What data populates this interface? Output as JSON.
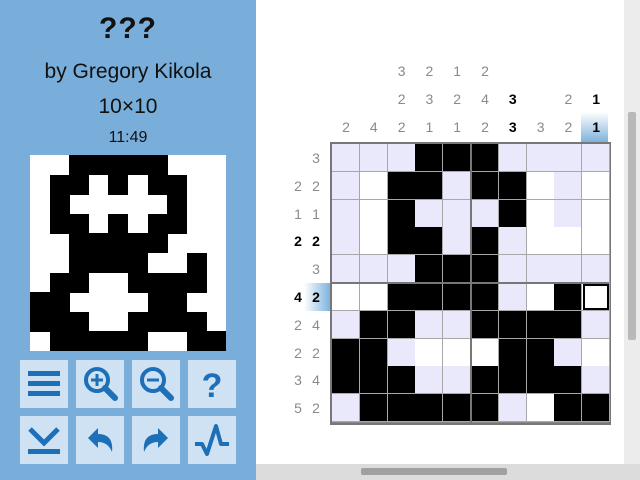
{
  "puzzle": {
    "title": "???",
    "author": "by Gregory Kikola",
    "size": "10×10",
    "timer": "11:49"
  },
  "toolbar": [
    {
      "name": "menu-button",
      "icon": "menu-icon"
    },
    {
      "name": "zoom-in-button",
      "icon": "zoom-in-icon"
    },
    {
      "name": "zoom-out-button",
      "icon": "zoom-out-icon"
    },
    {
      "name": "help-button",
      "icon": "help-icon"
    },
    {
      "name": "collapse-button",
      "icon": "collapse-down-icon"
    },
    {
      "name": "undo-button",
      "icon": "undo-icon"
    },
    {
      "name": "redo-button",
      "icon": "redo-icon"
    },
    {
      "name": "check-button",
      "icon": "check-icon"
    }
  ],
  "column_clues": [
    [
      "2"
    ],
    [
      "4"
    ],
    [
      "3",
      "2",
      "2"
    ],
    [
      "2",
      "3",
      "1"
    ],
    [
      "1",
      "2",
      "1"
    ],
    [
      "2",
      "4",
      "2"
    ],
    [
      "3",
      "3"
    ],
    [
      "3"
    ],
    [
      "2",
      "2"
    ],
    [
      "1",
      "1"
    ]
  ],
  "column_clues_complete": [
    [
      false
    ],
    [
      false
    ],
    [
      false,
      false,
      false
    ],
    [
      false,
      false,
      false
    ],
    [
      false,
      false,
      false
    ],
    [
      false,
      false,
      false
    ],
    [
      true,
      true
    ],
    [
      false
    ],
    [
      false,
      false
    ],
    [
      true,
      true
    ]
  ],
  "row_clues": [
    [
      "3"
    ],
    [
      "2",
      "2"
    ],
    [
      "1",
      "1"
    ],
    [
      "2",
      "2"
    ],
    [
      "3"
    ],
    [
      "4",
      "2"
    ],
    [
      "2",
      "4"
    ],
    [
      "2",
      "2"
    ],
    [
      "3",
      "4"
    ],
    [
      "5",
      "2"
    ]
  ],
  "row_clues_complete": [
    [
      false
    ],
    [
      false,
      false
    ],
    [
      false,
      false
    ],
    [
      true,
      true
    ],
    [
      false
    ],
    [
      true,
      true
    ],
    [
      false,
      false
    ],
    [
      false,
      false
    ],
    [
      false,
      false
    ],
    [
      false,
      false
    ]
  ],
  "grid": [
    [
      2,
      2,
      2,
      1,
      1,
      1,
      2,
      2,
      2,
      2
    ],
    [
      2,
      0,
      1,
      1,
      2,
      1,
      1,
      0,
      2,
      0
    ],
    [
      2,
      0,
      1,
      2,
      2,
      2,
      1,
      0,
      2,
      0
    ],
    [
      2,
      0,
      1,
      1,
      2,
      1,
      2,
      0,
      0,
      0
    ],
    [
      2,
      2,
      2,
      1,
      1,
      1,
      2,
      2,
      2,
      2
    ],
    [
      0,
      0,
      1,
      1,
      1,
      1,
      2,
      0,
      1,
      0
    ],
    [
      2,
      1,
      1,
      2,
      2,
      1,
      1,
      1,
      1,
      2
    ],
    [
      1,
      1,
      2,
      0,
      0,
      0,
      1,
      1,
      2,
      0
    ],
    [
      1,
      1,
      1,
      2,
      2,
      1,
      1,
      1,
      1,
      2
    ],
    [
      2,
      1,
      1,
      1,
      1,
      1,
      2,
      0,
      1,
      1
    ]
  ],
  "selected_cell": [
    5,
    9
  ],
  "preview": [
    [
      0,
      0,
      1,
      1,
      1,
      1,
      1,
      0,
      0,
      0
    ],
    [
      0,
      1,
      1,
      0,
      1,
      0,
      1,
      1,
      0,
      0
    ],
    [
      0,
      1,
      0,
      0,
      0,
      0,
      0,
      1,
      0,
      0
    ],
    [
      0,
      1,
      1,
      0,
      1,
      0,
      1,
      1,
      0,
      0
    ],
    [
      0,
      0,
      1,
      1,
      1,
      1,
      1,
      0,
      0,
      0
    ],
    [
      0,
      0,
      1,
      1,
      1,
      1,
      0,
      0,
      1,
      0
    ],
    [
      0,
      1,
      1,
      0,
      0,
      1,
      1,
      1,
      1,
      0
    ],
    [
      1,
      1,
      0,
      0,
      0,
      0,
      1,
      1,
      0,
      0
    ],
    [
      1,
      1,
      1,
      0,
      0,
      1,
      1,
      1,
      1,
      0
    ],
    [
      0,
      1,
      1,
      1,
      1,
      1,
      0,
      0,
      1,
      1
    ]
  ],
  "colors": {
    "sidebar_bg": "#79aedb",
    "button_bg": "#cfe2f3",
    "icon_blue": "#1d6fb8",
    "filled": "#000000",
    "empty": "#ffffff",
    "crossed_light": "#e9e9fb",
    "clue_done": "#8a8a8a",
    "clue_active": "#000000"
  }
}
